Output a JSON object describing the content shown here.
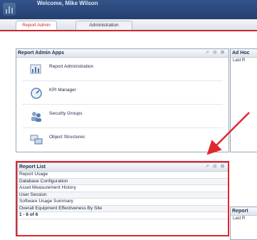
{
  "header": {
    "welcome": "Welcome, Mike Wilson"
  },
  "tabs": [
    {
      "label": "Report Admin",
      "active": true
    },
    {
      "label": "Administration",
      "active": false
    }
  ],
  "report_admin_apps": {
    "title": "Report Admin Apps",
    "tools": "↗ ⊟ ⊠",
    "items": [
      {
        "label": "Report Administration",
        "icon": "report-chart-icon"
      },
      {
        "label": "KPI Manager",
        "icon": "gauge-icon"
      },
      {
        "label": "Security Groups",
        "icon": "users-group-icon"
      },
      {
        "label": "Object Structures",
        "icon": "object-structure-icon"
      }
    ]
  },
  "ad_hoc": {
    "title": "Ad Hoc",
    "sub": "Last R"
  },
  "report_list": {
    "title": "Report List",
    "tools": "↗ ⊟ ⊠",
    "rows": [
      "Report Usage",
      "Database Configuration",
      "Asset Measurement History",
      "User Session",
      "Software Usage Summary",
      "Overall Equipment Effectiveness By Site"
    ],
    "count": "1 - 6 of 6"
  },
  "report_side": {
    "title": "Report",
    "sub": "Last R"
  },
  "colors": {
    "highlight": "#e0282f",
    "header": "#2b4a7e",
    "accent_tab": "#c8282f"
  }
}
